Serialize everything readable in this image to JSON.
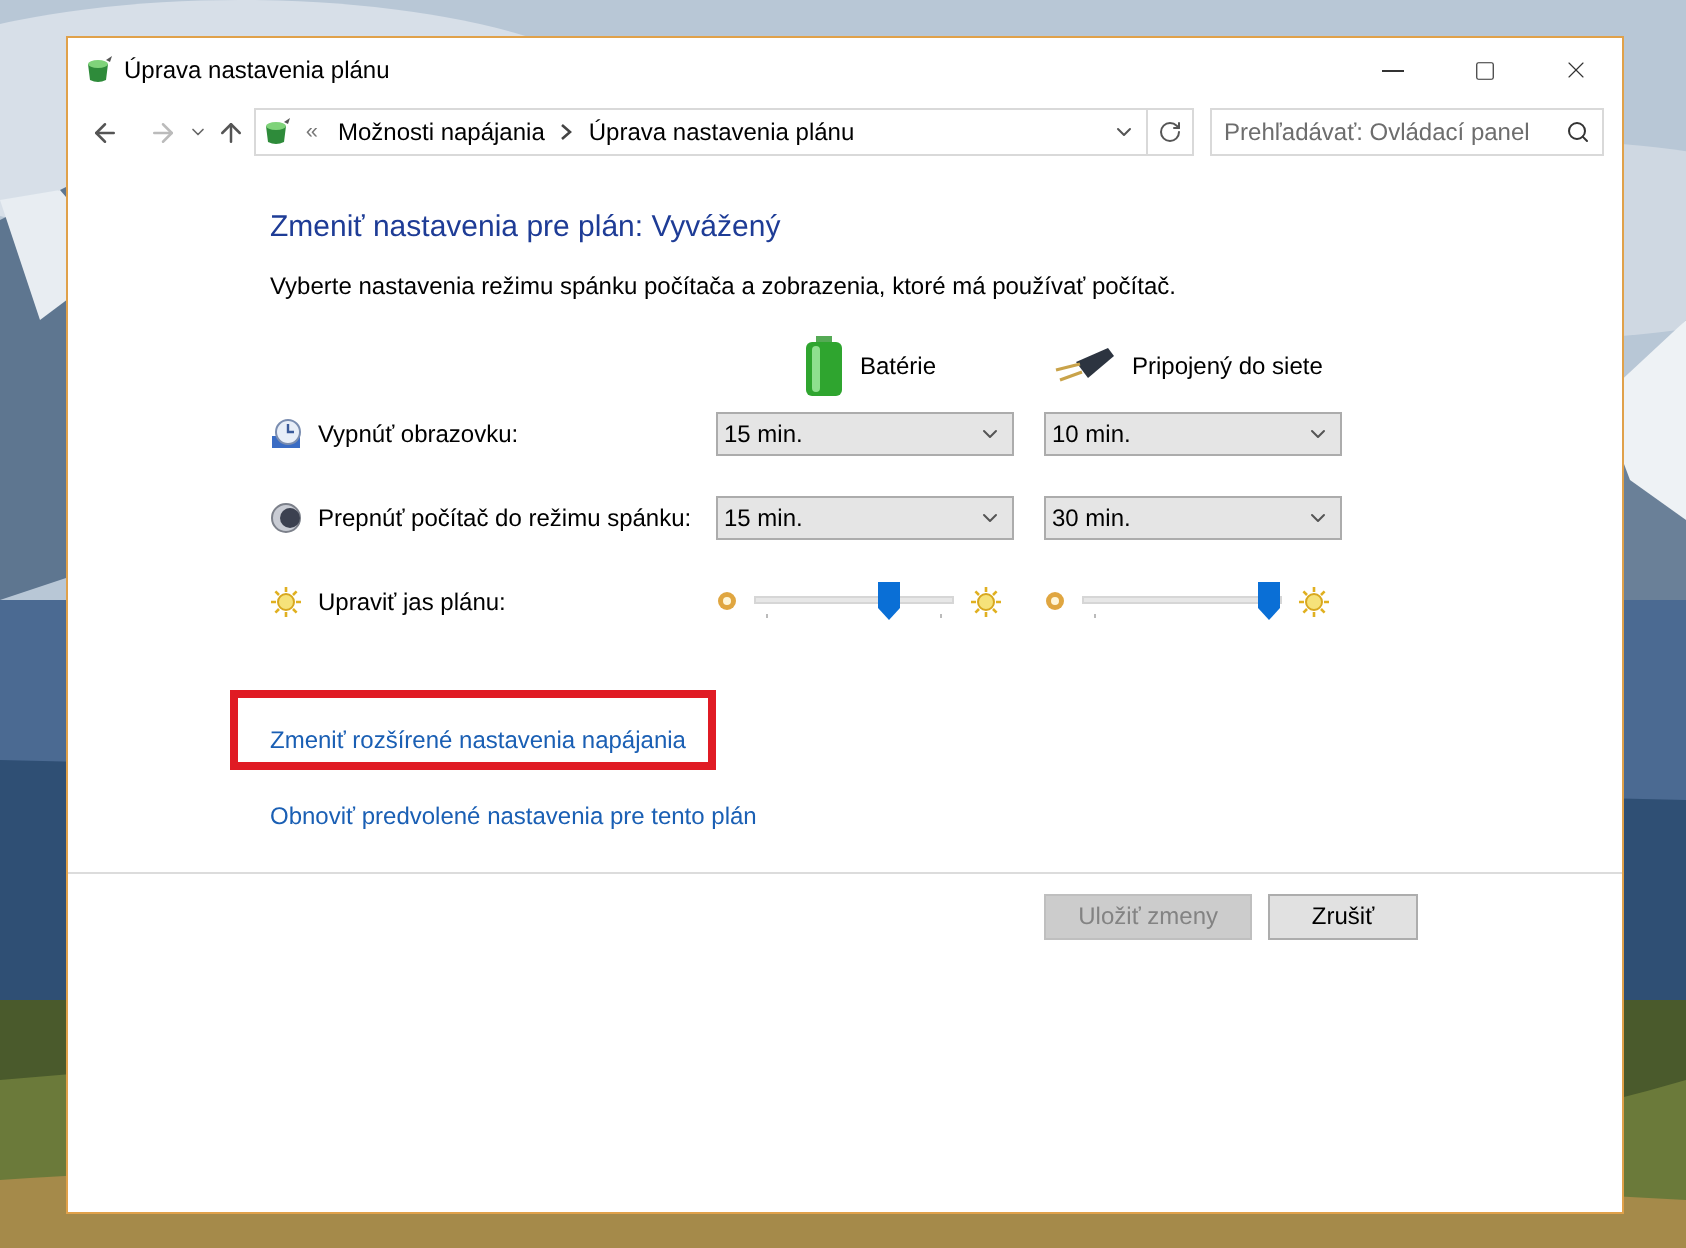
{
  "window": {
    "title": "Úprava nastavenia plánu"
  },
  "address_bar": {
    "separator": "«",
    "crumbs": [
      "Možnosti napájania",
      "Úprava nastavenia plánu"
    ]
  },
  "search": {
    "placeholder": "Prehľadávať: Ovládací panel"
  },
  "heading": "Zmeniť nastavenia pre plán: Vyvážený",
  "description": "Vyberte nastavenia režimu spánku počítača a zobrazenia, ktoré má používať počítač.",
  "columns": [
    {
      "kind": "battery",
      "label": "Batérie"
    },
    {
      "kind": "plug",
      "label": "Pripojený do siete"
    }
  ],
  "settings": [
    {
      "kind": "dropdown",
      "label": "Vypnúť obrazovku:",
      "values": [
        "15 min.",
        "10 min."
      ]
    },
    {
      "kind": "dropdown",
      "label": "Prepnúť počítač do režimu spánku:",
      "values": [
        "15 min.",
        "30 min."
      ]
    },
    {
      "kind": "slider",
      "label": "Upraviť jas plánu:",
      "levels": [
        {
          "level": 0.68
        },
        {
          "level": 0.94
        }
      ]
    }
  ],
  "links": [
    {
      "text": "Zmeniť rozšírené nastavenia napájania",
      "highlighted": true
    },
    {
      "text": "Obnoviť predvolené nastavenia pre tento plán",
      "highlighted": false
    }
  ],
  "buttons": [
    {
      "label": "Uložiť zmeny",
      "disabled": true
    },
    {
      "label": "Zrušiť",
      "disabled": false
    }
  ]
}
